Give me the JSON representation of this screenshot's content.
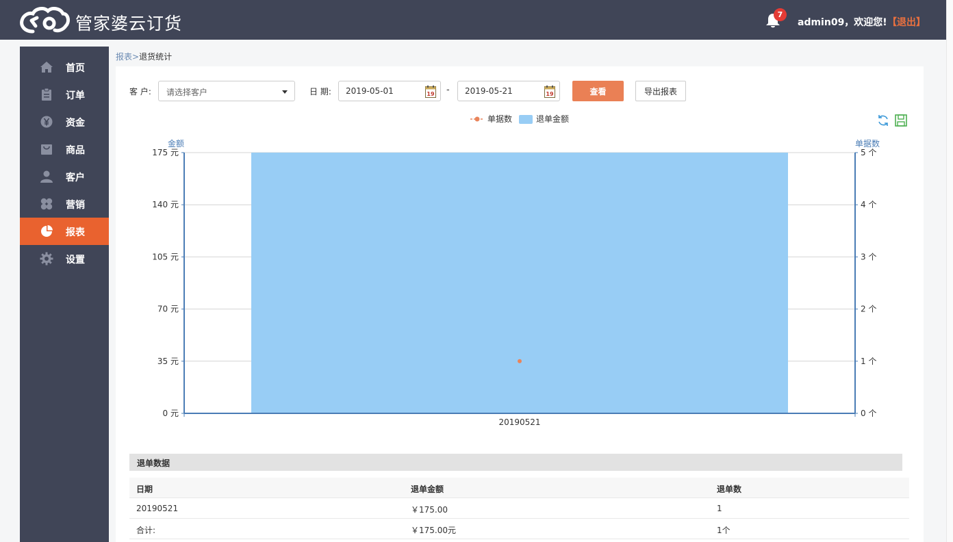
{
  "header": {
    "brand": "管家婆云订货",
    "notifications_count": "7",
    "user_greeting": "admin09，欢迎您!",
    "logout_label": "【退出】"
  },
  "sidebar": {
    "items": [
      {
        "label": "首页",
        "icon": "home-icon"
      },
      {
        "label": "订单",
        "icon": "clipboard-icon"
      },
      {
        "label": "资金",
        "icon": "yen-icon"
      },
      {
        "label": "商品",
        "icon": "bag-icon"
      },
      {
        "label": "客户",
        "icon": "user-icon"
      },
      {
        "label": "营销",
        "icon": "clover-icon"
      },
      {
        "label": "报表",
        "icon": "pie-chart-icon",
        "active": true
      },
      {
        "label": "设置",
        "icon": "gear-icon"
      }
    ],
    "colors": {
      "bg": "#404557",
      "active": "#e9622f"
    }
  },
  "breadcrumb": {
    "parent": "报表",
    "separator": ">",
    "current": "退货统计"
  },
  "filters": {
    "customer_label": "客 户:",
    "customer_placeholder": "请选择客户",
    "date_label": "日 期:",
    "date_from": "2019-05-01",
    "date_to": "2019-05-21",
    "date_separator": "-",
    "view_button": "查看",
    "export_button": "导出报表"
  },
  "chart_data": {
    "type": "bar",
    "categories": [
      "20190521"
    ],
    "series": [
      {
        "name": "退单金额",
        "type": "bar",
        "axis": "left",
        "color": "#98cdf5",
        "values": [
          175
        ]
      },
      {
        "name": "单据数",
        "type": "line",
        "axis": "right",
        "color": "#e9845b",
        "values": [
          1
        ]
      }
    ],
    "y_left": {
      "label": "金额",
      "ticks": [
        "0 元",
        "35 元",
        "70 元",
        "105 元",
        "140 元",
        "175 元"
      ],
      "range": [
        0,
        175
      ]
    },
    "y_right": {
      "label": "单据数",
      "ticks": [
        "0 个",
        "1 个",
        "2 个",
        "3 个",
        "4 个",
        "5 个"
      ],
      "range": [
        0,
        5
      ]
    },
    "legend_position": "top-center",
    "grid": true
  },
  "table": {
    "section_title": "退单数据",
    "columns": [
      "日期",
      "退单金额",
      "退单数"
    ],
    "rows": [
      [
        "20190521",
        "￥175.00",
        "1"
      ]
    ],
    "total": [
      "合计:",
      "￥175.00元",
      "1个"
    ]
  }
}
